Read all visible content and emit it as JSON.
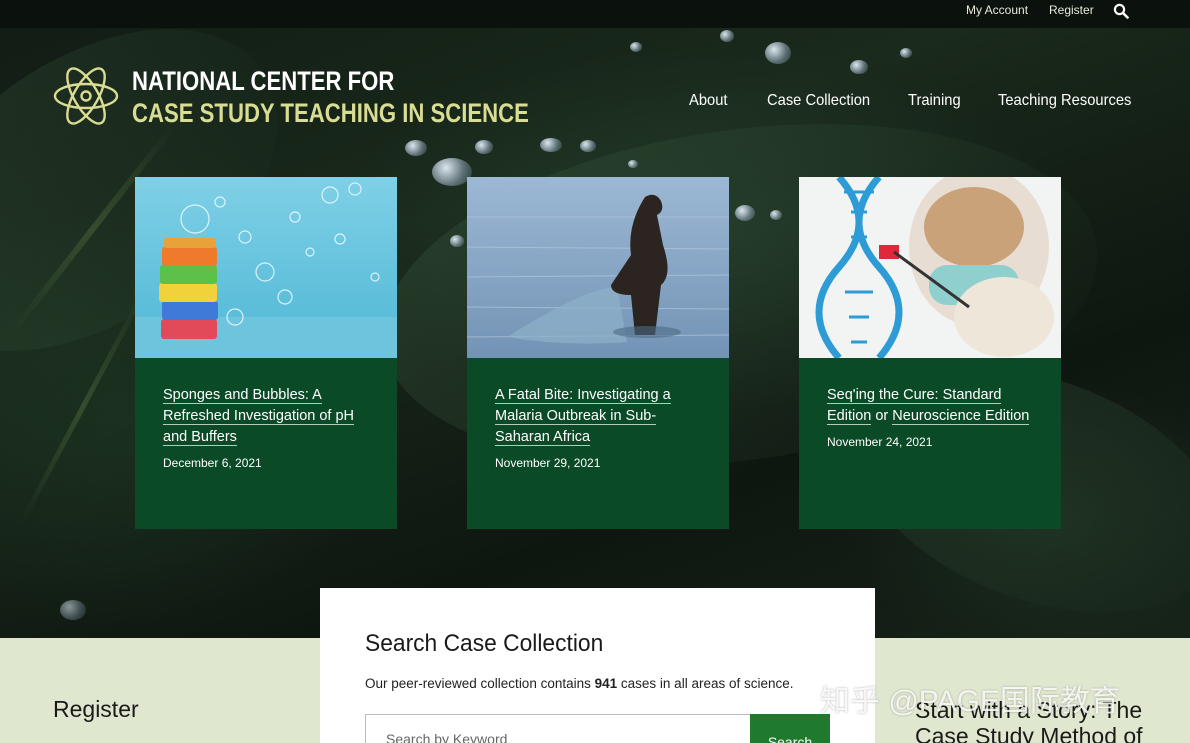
{
  "utility": {
    "my_account": "My Account",
    "register": "Register"
  },
  "logo": {
    "line1": "NATIONAL CENTER FOR",
    "line2": "CASE STUDY TEACHING IN SCIENCE"
  },
  "nav": [
    {
      "label": "About"
    },
    {
      "label": "Case Collection"
    },
    {
      "label": "Training"
    },
    {
      "label": "Teaching Resources"
    }
  ],
  "cards": [
    {
      "title": "Sponges and Bubbles: A Refreshed Investigation of pH and Buffers",
      "date": "December 6, 2021"
    },
    {
      "title": "A Fatal Bite: Investigating a Malaria Outbreak in Sub-Saharan Africa",
      "date": "November 29, 2021"
    },
    {
      "title_part1": "Seq'ing the Cure: Standard Edition",
      "title_join": " or ",
      "title_part2": "Neuroscience Edition",
      "date": "November 24, 2021"
    }
  ],
  "search": {
    "title": "Search Case Collection",
    "desc_before": "Our peer-reviewed collection contains ",
    "desc_count": "941",
    "desc_after": " cases in all areas of science.",
    "placeholder": "Search by Keyword",
    "button": "Search"
  },
  "band": {
    "register_heading": "Register",
    "story_heading": "Start with a Story: The Case Study Method of"
  },
  "watermark": "知乎 @PAGE国际教育",
  "colors": {
    "card_green": "#0b4a26",
    "band_bg": "#dfe8cf",
    "logo_accent": "#d9dc93",
    "button_green": "#1f7a2e"
  }
}
